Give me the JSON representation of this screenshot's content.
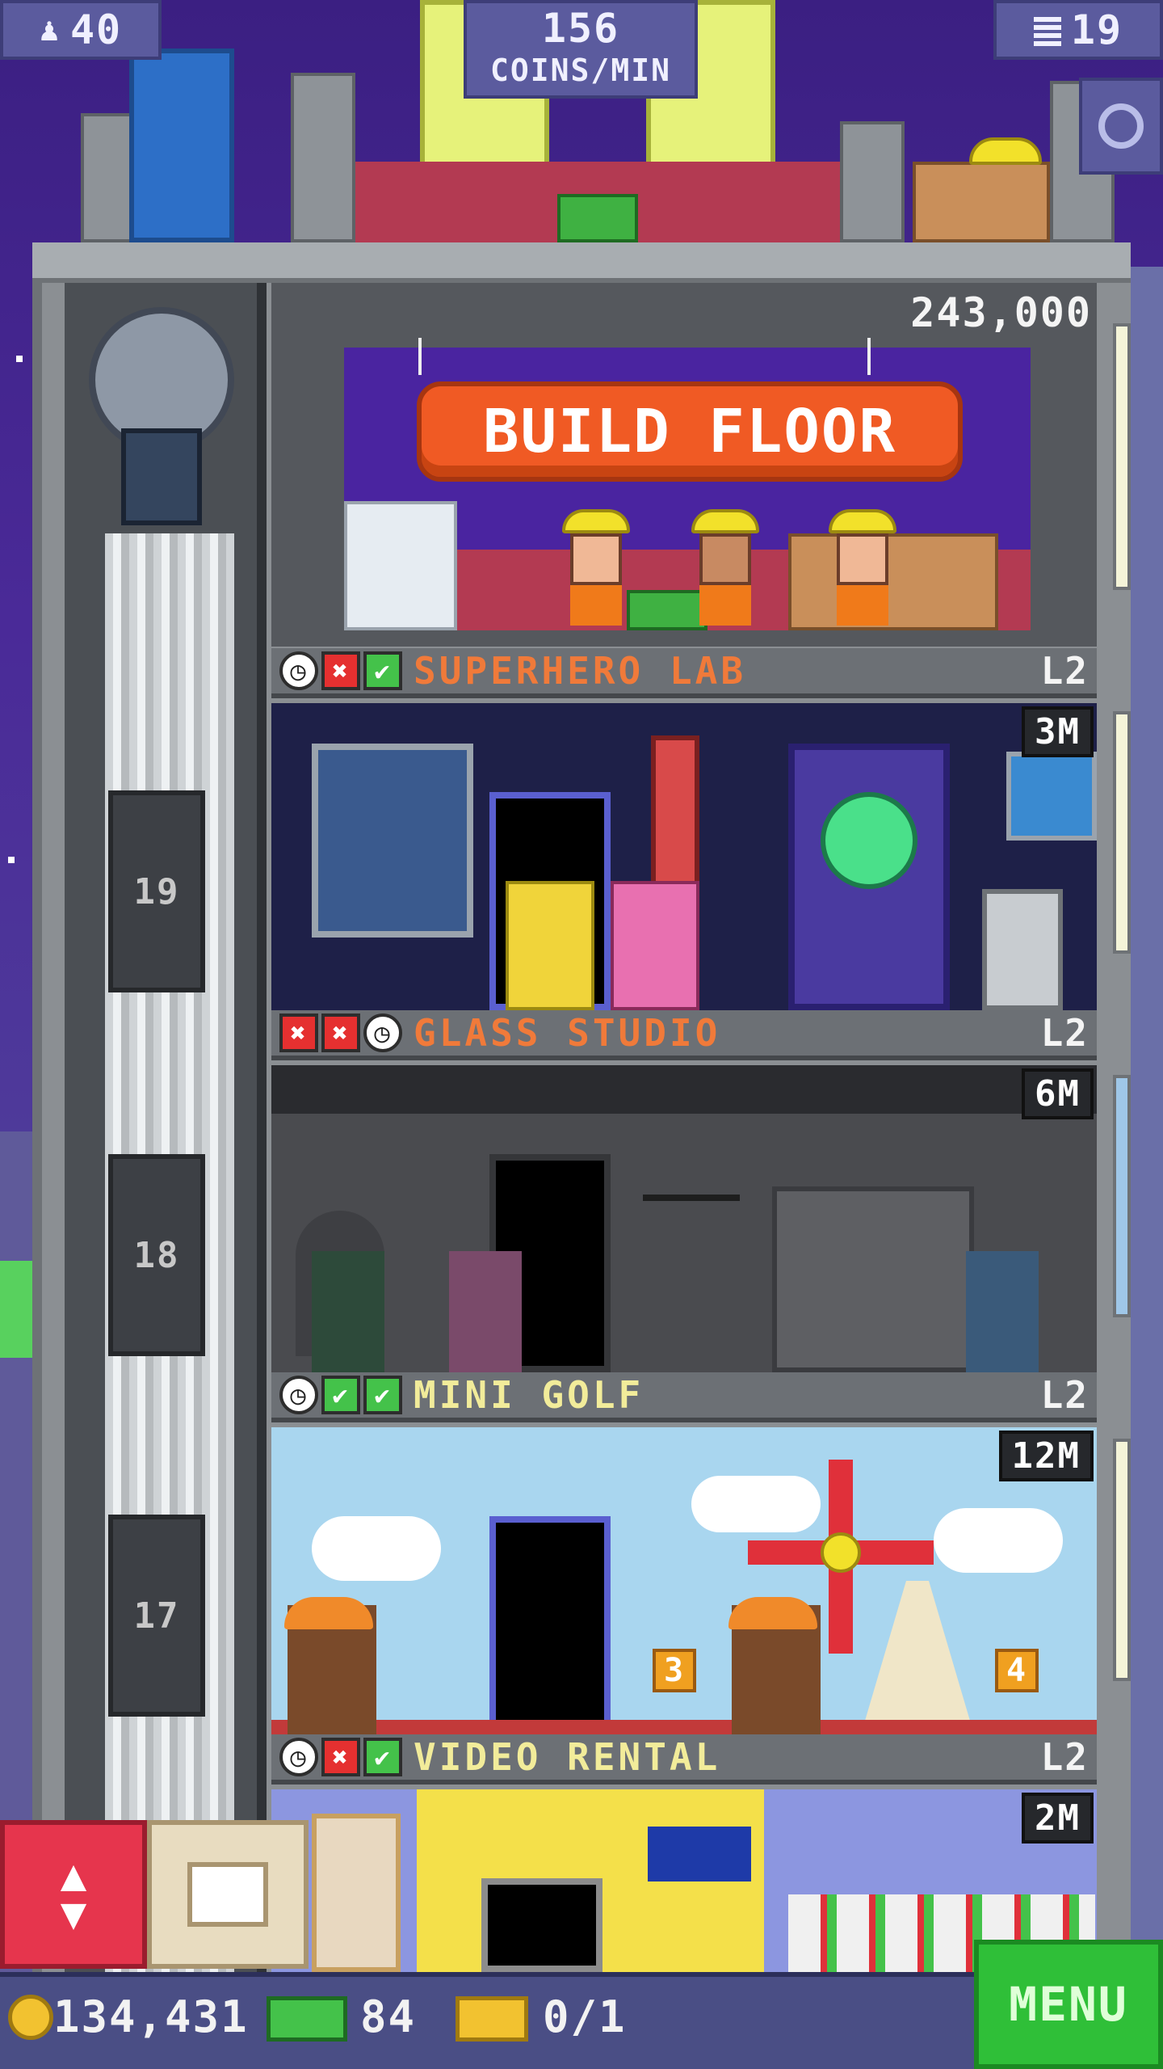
{
  "hud": {
    "population": "40",
    "coins_per_min_value": "156",
    "coins_per_min_label": "COINS/MIN",
    "floors": "19"
  },
  "build_floor": {
    "cost": "243,000",
    "button_label": "BUILD FLOOR"
  },
  "floors": [
    {
      "name": "SUPERHERO LAB",
      "level": "L2",
      "value": "3M",
      "status": [
        "clock",
        "x",
        "check"
      ],
      "name_color": "#f07a3a",
      "number": "19"
    },
    {
      "name": "GLASS STUDIO",
      "level": "L2",
      "value": "6M",
      "status": [
        "x",
        "x",
        "clock"
      ],
      "name_color": "#f07a3a",
      "number": "18"
    },
    {
      "name": "MINI GOLF",
      "level": "L2",
      "value": "12M",
      "status": [
        "clock",
        "check",
        "check"
      ],
      "name_color": "#f2ec9a",
      "number": "17"
    },
    {
      "name": "VIDEO RENTAL",
      "level": "L2",
      "value": "2M",
      "status": [
        "clock",
        "x",
        "check"
      ],
      "name_color": "#f2ec9a"
    }
  ],
  "golf_holes": [
    "3",
    "4"
  ],
  "bottom": {
    "coins": "134,431",
    "bux": "84",
    "tickets": "0/1",
    "menu_label": "MENU"
  },
  "colors": {
    "build_button": "#f05a24",
    "menu_button": "#2fbf38",
    "elevator_button": "#e6354d"
  },
  "icons": [
    "person-icon",
    "building-icon",
    "magnify-icon",
    "clock-icon",
    "x-icon",
    "check-icon",
    "coin-icon",
    "bux-icon",
    "ticket-icon",
    "elevator-arrows-icon",
    "box-icon"
  ]
}
